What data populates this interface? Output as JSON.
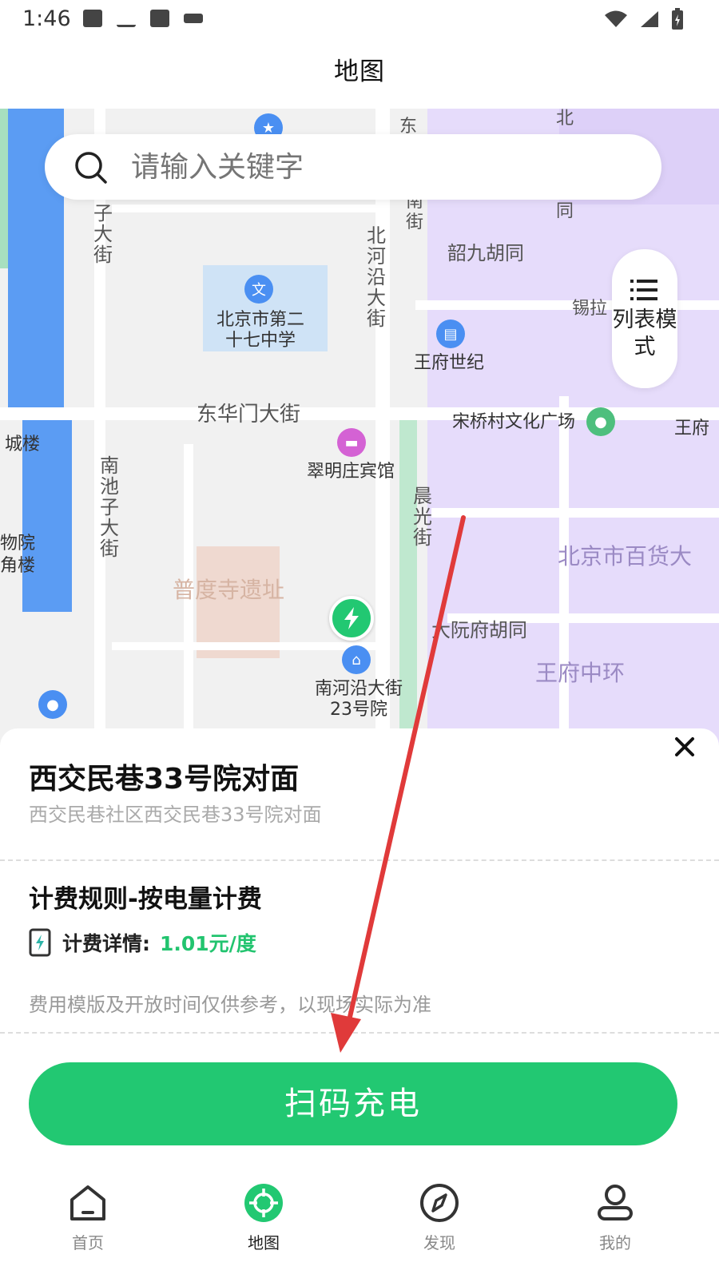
{
  "status_bar": {
    "time": "1:46"
  },
  "header": {
    "title": "地图"
  },
  "search": {
    "placeholder": "请输入关键字"
  },
  "list_mode": {
    "label": "列表模式"
  },
  "map_labels": {
    "dong_huamen": "东华门大街",
    "school": "北京市第二十七中学",
    "cuiming": "翠明庄宾馆",
    "wangfu_shiji": "王府世纪",
    "shao_jiu": "韶九胡同",
    "song_qiao": "宋桥村文化广场",
    "pudu_si": "普度寺遗址",
    "bei_he_yan": "北河沿大街",
    "nan_chizi": "南池子大街",
    "chen_guang": "晨光街",
    "da_yuan_fu": "大阮府胡同",
    "wangfu_zhonghuan": "王府中环",
    "baihuo": "北京市百货大",
    "nanheyan_23": "南河沿大街23号院",
    "cheng_lou": "城楼",
    "wuyuan": "物院",
    "jiaolou": "角楼",
    "xi_la": "锡拉",
    "wang_fu": "王府",
    "zi_da_jie": "子大街",
    "dong": "东",
    "bei": "北",
    "tong": "同",
    "nan_jie": "南街"
  },
  "station": {
    "name": "西交民巷33号院对面",
    "address": "西交民巷社区西交民巷33号院对面",
    "fee_rule": "计费规则-按电量计费",
    "fee_label": "计费详情:",
    "fee_value": "1.01元/度",
    "note": "费用模版及开放时间仅供参考，以现场实际为准"
  },
  "scan_button": {
    "label": "扫码充电"
  },
  "tabs": [
    {
      "label": "首页",
      "icon": "home-icon"
    },
    {
      "label": "地图",
      "icon": "map-icon"
    },
    {
      "label": "发现",
      "icon": "compass-icon"
    },
    {
      "label": "我的",
      "icon": "user-icon"
    }
  ],
  "colors": {
    "accent": "#22c872",
    "fee": "#22c46f",
    "annotation_arrow": "#e03a3a"
  }
}
